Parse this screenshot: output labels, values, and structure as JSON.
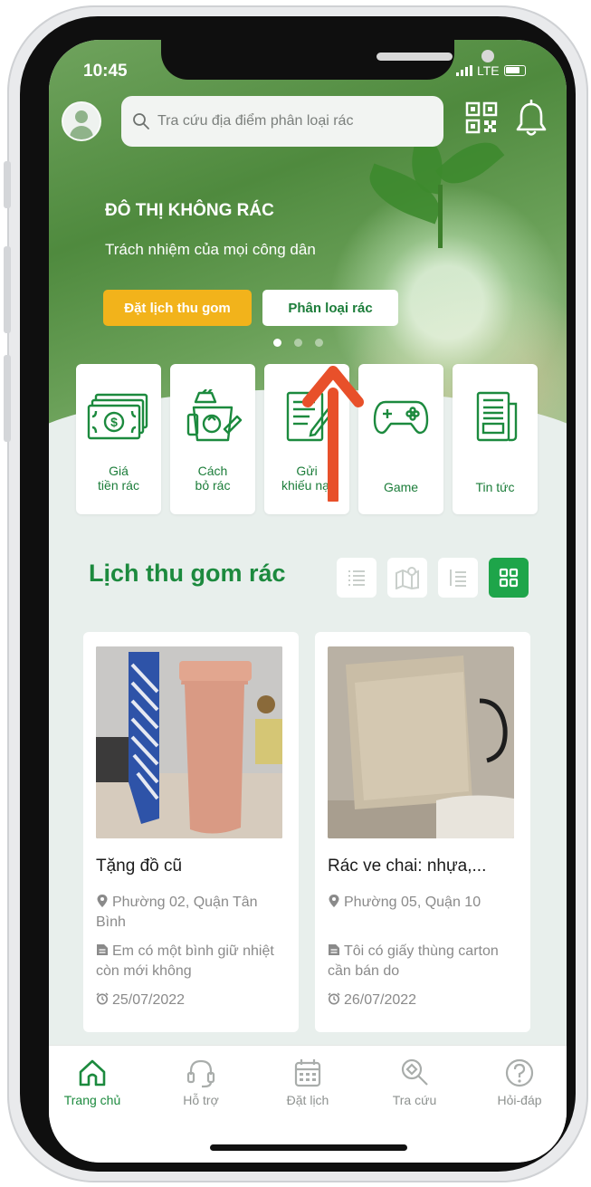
{
  "status_bar": {
    "time": "10:45",
    "network": "LTE"
  },
  "search": {
    "placeholder": "Tra cứu địa điểm phân loại rác"
  },
  "hero": {
    "title": "ĐÔ THỊ KHÔNG RÁC",
    "subtitle": "Trách nhiệm của mọi công dân",
    "primary_button": "Đặt lịch thu gom",
    "secondary_button": "Phân loại rác",
    "carousel": {
      "total": 3,
      "active_index": 0
    }
  },
  "features": [
    {
      "line1": "Giá",
      "line2": "tiền rác",
      "icon": "money-icon"
    },
    {
      "line1": "Cách",
      "line2": "bỏ rác",
      "icon": "recycle-bin-icon"
    },
    {
      "line1": "Gửi",
      "line2": "khiếu nại",
      "icon": "complaint-form-icon"
    },
    {
      "line1": "Game",
      "line2": "",
      "icon": "gamepad-icon"
    },
    {
      "line1": "Tin tức",
      "line2": "",
      "icon": "newspaper-icon"
    }
  ],
  "section": {
    "title": "Lịch thu gom rác",
    "view_modes": [
      "list-view",
      "map-view",
      "numbered-list-view",
      "grid-view"
    ],
    "active_view": "grid-view"
  },
  "posts": [
    {
      "title": "Tặng đồ cũ",
      "location": "Phường 02, Quận Tân Bình",
      "description": "Em có một bình giữ nhiệt còn mới không",
      "date": "25/07/2022"
    },
    {
      "title": "Rác ve chai: nhựa,...",
      "location": "Phường 05, Quận 10",
      "description": "Tôi có giấy thùng carton cần bán do",
      "date": "26/07/2022"
    }
  ],
  "bottom_nav": [
    {
      "label": "Trang chủ",
      "icon": "home-icon",
      "active": true
    },
    {
      "label": "Hỗ trợ",
      "icon": "headset-icon",
      "active": false
    },
    {
      "label": "Đặt lịch",
      "icon": "calendar-icon",
      "active": false
    },
    {
      "label": "Tra cứu",
      "icon": "search-magnifier-icon",
      "active": false
    },
    {
      "label": "Hỏi-đáp",
      "icon": "help-icon",
      "active": false
    }
  ],
  "colors": {
    "brand_green": "#1c8a3e",
    "accent_yellow": "#f2b31b",
    "annotation_arrow": "#e8502a"
  }
}
